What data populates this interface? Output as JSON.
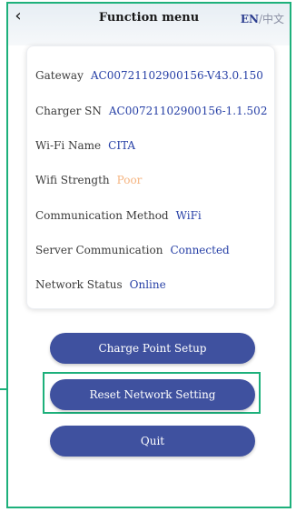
{
  "header": {
    "back_icon": "‹",
    "title": "Function menu",
    "lang_en": "EN",
    "lang_sep": "/",
    "lang_zh": "中文"
  },
  "info": [
    {
      "label": "Gateway",
      "value": "AC00721102900156-V43.0.150"
    },
    {
      "label": "Charger SN",
      "value": "AC00721102900156-1.1.502"
    },
    {
      "label": "Wi-Fi Name",
      "value": "CITA"
    },
    {
      "label": "Wifi Strength",
      "value": "Poor"
    },
    {
      "label": "Communication Method",
      "value": "WiFi"
    },
    {
      "label": "Server Communication",
      "value": "Connected"
    },
    {
      "label": "Network Status",
      "value": "Online"
    }
  ],
  "buttons": {
    "charge_point_setup": "Charge Point Setup",
    "reset_network": "Reset Network Setting",
    "quit": "Quit"
  },
  "colors": {
    "accent_frame": "#1db07b",
    "button_bg": "#3f519f",
    "value_text": "#2740a6",
    "warning_text": "#f5b582"
  }
}
